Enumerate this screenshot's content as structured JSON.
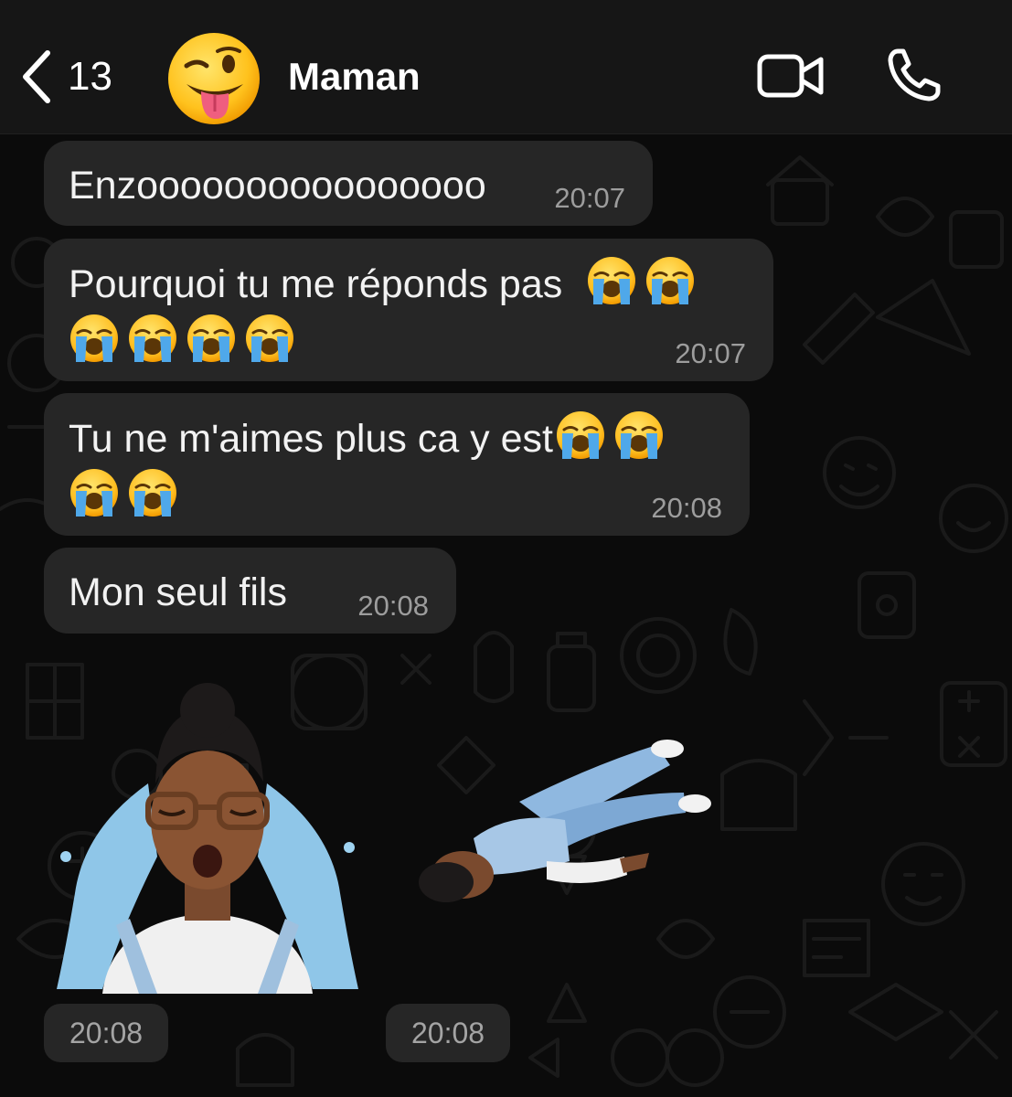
{
  "header": {
    "unread_count": "13",
    "contact_name": "Maman",
    "avatar_icon": "winking-face-with-tongue-emoji",
    "video_call_icon": "video-camera-icon",
    "voice_call_icon": "phone-icon"
  },
  "messages": [
    {
      "text": "Enzoooooooooooooooo",
      "time": "20:07"
    },
    {
      "line1": "Pourquoi tu me réponds pas",
      "emoji_icon": "loudly-crying-face-emoji",
      "time": "20:07"
    },
    {
      "line1": "Tu ne m'aimes plus ca y est",
      "emoji_icon": "loudly-crying-face-emoji",
      "time": "20:08"
    },
    {
      "text": "Mon seul fils",
      "time": "20:08"
    }
  ],
  "stickers": [
    {
      "name": "crying-avatar-sticker",
      "time": "20:08"
    },
    {
      "name": "lying-down-avatar-sticker",
      "time": "20:08"
    }
  ],
  "colors": {
    "header_bg": "#161616",
    "chat_bg": "#0b0b0b",
    "bubble_bg": "#262626",
    "time_text": "#9d9d9d"
  }
}
